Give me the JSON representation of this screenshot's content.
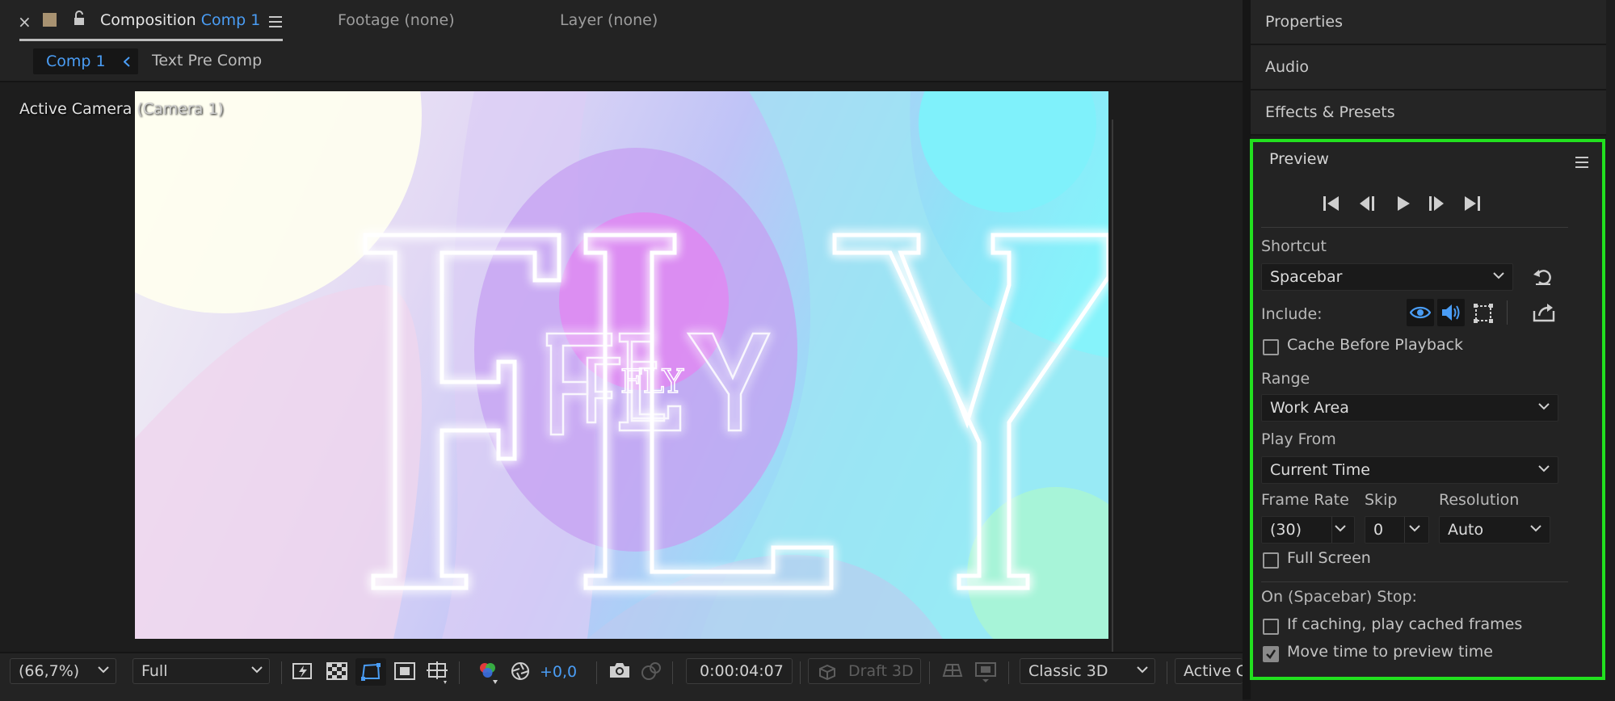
{
  "comp_tabs": {
    "close_symbol": "×",
    "composition_label": "Composition",
    "composition_name": "Comp 1",
    "footage": "Footage (none)",
    "layer": "Layer (none)"
  },
  "viewer_tabs": {
    "active": "Comp 1",
    "other": "Text Pre Comp"
  },
  "viewer": {
    "camera_label": "Active Camera",
    "camera_sub": "(Camera 1)",
    "canvas_title": "FLY",
    "canvas_small_text": "FLY"
  },
  "bottom_bar": {
    "zoom": "(66,7%)",
    "resolution": "Full",
    "exposure": "+0,0",
    "timecode": "0:00:04:07",
    "draft3d": "Draft 3D",
    "renderer": "Classic 3D",
    "camera_view": "Active C"
  },
  "right_panels": {
    "properties": "Properties",
    "audio": "Audio",
    "effects": "Effects & Presets"
  },
  "preview": {
    "title": "Preview",
    "shortcut_label": "Shortcut",
    "shortcut_value": "Spacebar",
    "include_label": "Include:",
    "cache_before_playback": "Cache Before Playback",
    "cache_before_playback_checked": false,
    "range_label": "Range",
    "range_value": "Work Area",
    "play_from_label": "Play From",
    "play_from_value": "Current Time",
    "frame_rate_label": "Frame Rate",
    "frame_rate_value": "(30)",
    "skip_label": "Skip",
    "skip_value": "0",
    "resolution_label": "Resolution",
    "resolution_value": "Auto",
    "full_screen": "Full Screen",
    "full_screen_checked": false,
    "on_stop_label": "On (Spacebar) Stop:",
    "if_caching": "If caching, play cached frames",
    "if_caching_checked": false,
    "move_time": "Move time to preview time",
    "move_time_checked": true
  },
  "colors": {
    "accent_blue": "#4a9df5",
    "highlight_green": "#22e01f",
    "panel_bg": "#232323"
  }
}
